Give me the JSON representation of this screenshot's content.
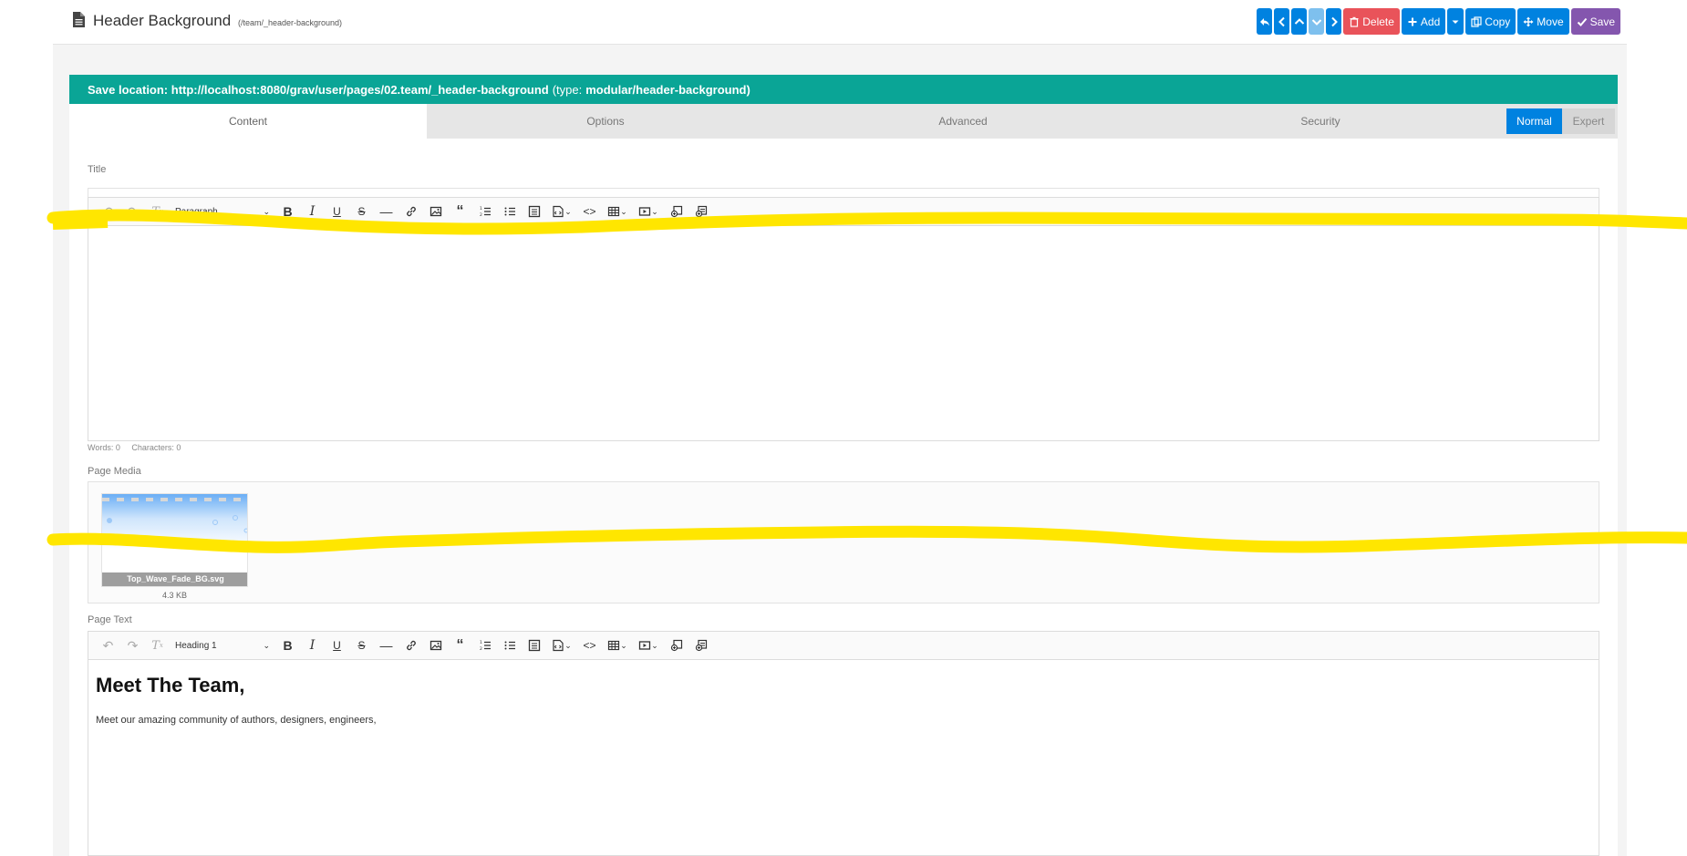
{
  "header": {
    "title": "Header Background",
    "route": "(/team/_header-background)"
  },
  "toolbar": {
    "delete_label": "Delete",
    "add_label": "Add",
    "copy_label": "Copy",
    "move_label": "Move",
    "save_label": "Save"
  },
  "save_location": {
    "label": "Save location: http://localhost:8080/grav/user/pages/02.team/_header-background",
    "type_prefix": "(type:",
    "type_value": "modular/header-background)"
  },
  "tabs": [
    {
      "label": "Content",
      "active": true
    },
    {
      "label": "Options",
      "active": false
    },
    {
      "label": "Advanced",
      "active": false
    },
    {
      "label": "Security",
      "active": false
    }
  ],
  "mode": {
    "normal_label": "Normal",
    "expert_label": "Expert",
    "selected": "Normal"
  },
  "title_field": {
    "label": "Title",
    "value": "Header Background"
  },
  "editor1": {
    "block_format": "Paragraph",
    "words": "Words: 0",
    "characters": "Characters: 0"
  },
  "page_media": {
    "label": "Page Media",
    "file_name": "Top_Wave_Fade_BG.svg",
    "file_size": "4.3 KB"
  },
  "page_text": {
    "label": "Page Text",
    "block_format": "Heading 1",
    "heading": "Meet The Team,",
    "paragraph": "Meet our amazing community of authors, designers, engineers,"
  },
  "colors": {
    "accent_blue": "#0082e0",
    "teal": "#0aa596",
    "delete_red": "#e9535a",
    "save_purple": "#8456ae",
    "highlighter": "#ffe600"
  }
}
